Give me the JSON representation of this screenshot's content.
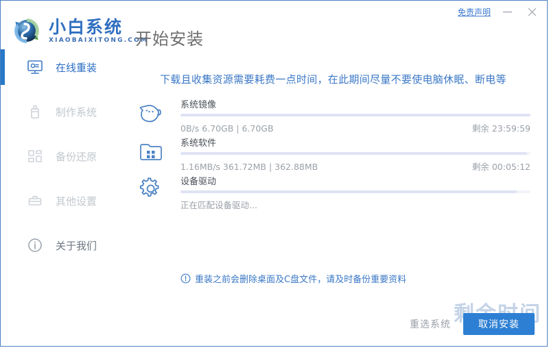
{
  "window": {
    "logo_cn": "小白系统",
    "logo_en": "XIAOBAIXITONG.COM",
    "title": "开始安装",
    "disclaimer": "免责声明",
    "minimize_icon": "minimize-icon",
    "close_icon": "close-icon",
    "border_color": "#4a7fc0"
  },
  "sidebar": {
    "items": [
      {
        "label": "在线重装",
        "icon": "monitor-refresh-icon",
        "state": "active"
      },
      {
        "label": "制作系统",
        "icon": "usb-drive-icon",
        "state": "disabled"
      },
      {
        "label": "备份还原",
        "icon": "backup-blocks-icon",
        "state": "disabled"
      },
      {
        "label": "其他设置",
        "icon": "toolbox-icon",
        "state": "disabled"
      },
      {
        "label": "关于我们",
        "icon": "info-circle-icon",
        "state": "normal"
      }
    ],
    "accent_color": "#2878c8"
  },
  "main": {
    "warning": "下载且收集资源需要耗费一点时间，在此期间尽量不要使电脑休眠、断电等",
    "warning_color": "#3b78c6",
    "tasks": [
      {
        "name": "系统镜像",
        "icon": "cloud-face-icon",
        "stats": "0B/s 6.70GB | 6.70GB",
        "remaining": "剩余 23:59:59",
        "progress_percent": 100
      },
      {
        "name": "系统软件",
        "icon": "folder-apps-icon",
        "stats": "1.16MB/s 361.72MB | 362.88MB",
        "remaining": "剩余 00:05:12",
        "progress_percent": 99
      },
      {
        "name": "设备驱动",
        "icon": "gear-icon",
        "stats": "正在匹配设备驱动...",
        "remaining": "",
        "progress_percent": 96
      }
    ],
    "notice": {
      "icon": "exclamation-circle-icon",
      "text": "重装之前会删除桌面及C盘文件，请及时备份重要资料",
      "color": "#3b78c6"
    }
  },
  "footer": {
    "reselect_label": "重选系统",
    "cancel_label": "取消安装",
    "primary_color": "#2d7fd4"
  },
  "watermark": {
    "text": "剩余时间"
  }
}
